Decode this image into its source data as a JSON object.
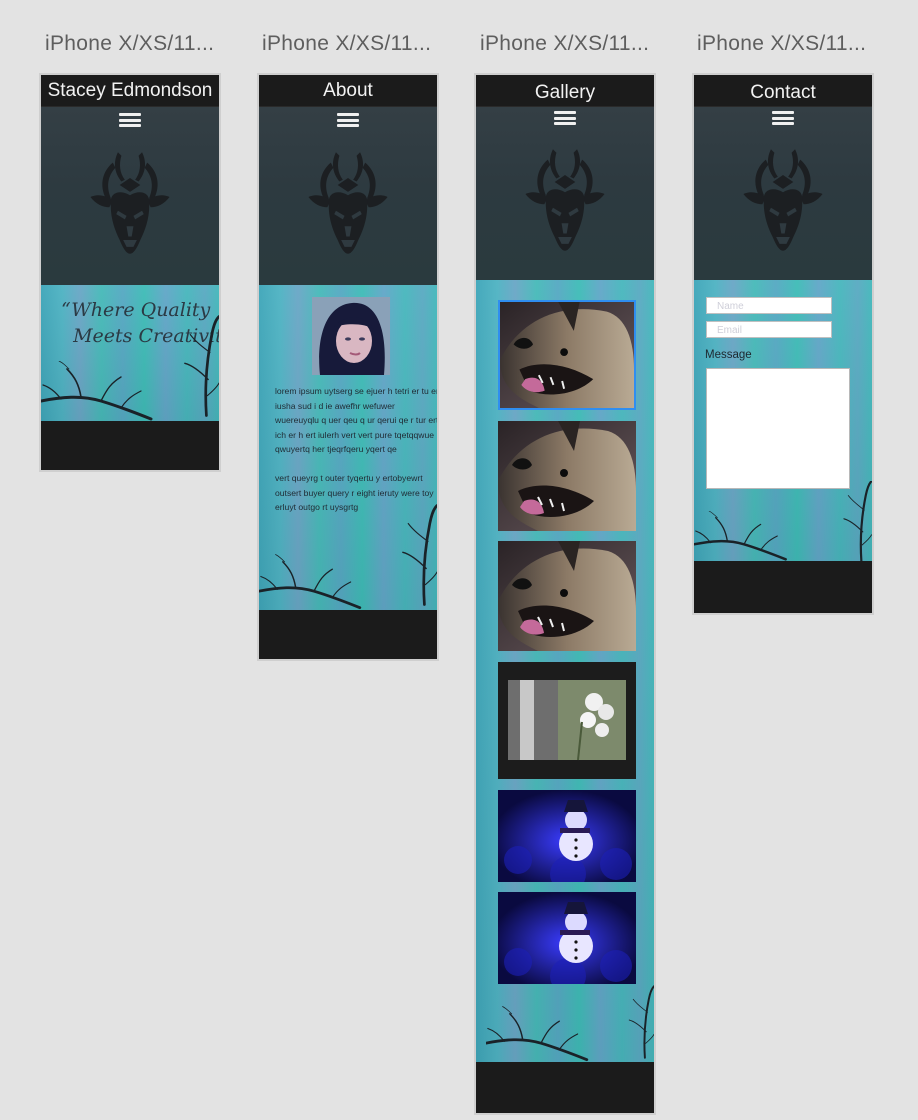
{
  "artboards": [
    {
      "label": "iPhone X/XS/11...",
      "title": "Stacey Edmondson"
    },
    {
      "label": "iPhone X/XS/11...",
      "title": "About"
    },
    {
      "label": "iPhone X/XS/11...",
      "title": "Gallery"
    },
    {
      "label": "iPhone X/XS/11...",
      "title": "Contact"
    }
  ],
  "home": {
    "quote_line1": "“Where Quality",
    "quote_line2": "Meets Creativity”"
  },
  "about": {
    "paragraph1": "lorem ipsum uytserg se  ejuer h tetri er tu er iusha  sud i d ie awefhr wefuwer wuereuyqlu q  uer qeu q  ur qerui qe r tur  ert ich  er h ert  iulerh vert vert pure tqetqqwue qwuyertq her tjeqrfqeru yqert qe",
    "paragraph2": "vert queyrg t outer tyqertu y ertobyewrt outsert buyer query r eight ieruty were toy erluyt outgo rt uysgrtg"
  },
  "gallery": {
    "images": [
      "dog-photo",
      "dog-photo",
      "dog-photo",
      "orchid-window-photo",
      "snowman-photo",
      "snowman-photo"
    ]
  },
  "contact": {
    "name_placeholder": "Name",
    "email_placeholder": "Email",
    "message_label": "Message"
  },
  "icons": {
    "menu": "hamburger-menu-icon",
    "logo": "deer-head-logo"
  },
  "colors": {
    "header_bar": "#1b1b1b",
    "hero_dark": "#2d3a40",
    "teal": "#4fb3c3",
    "selection": "#2f8ef0"
  }
}
